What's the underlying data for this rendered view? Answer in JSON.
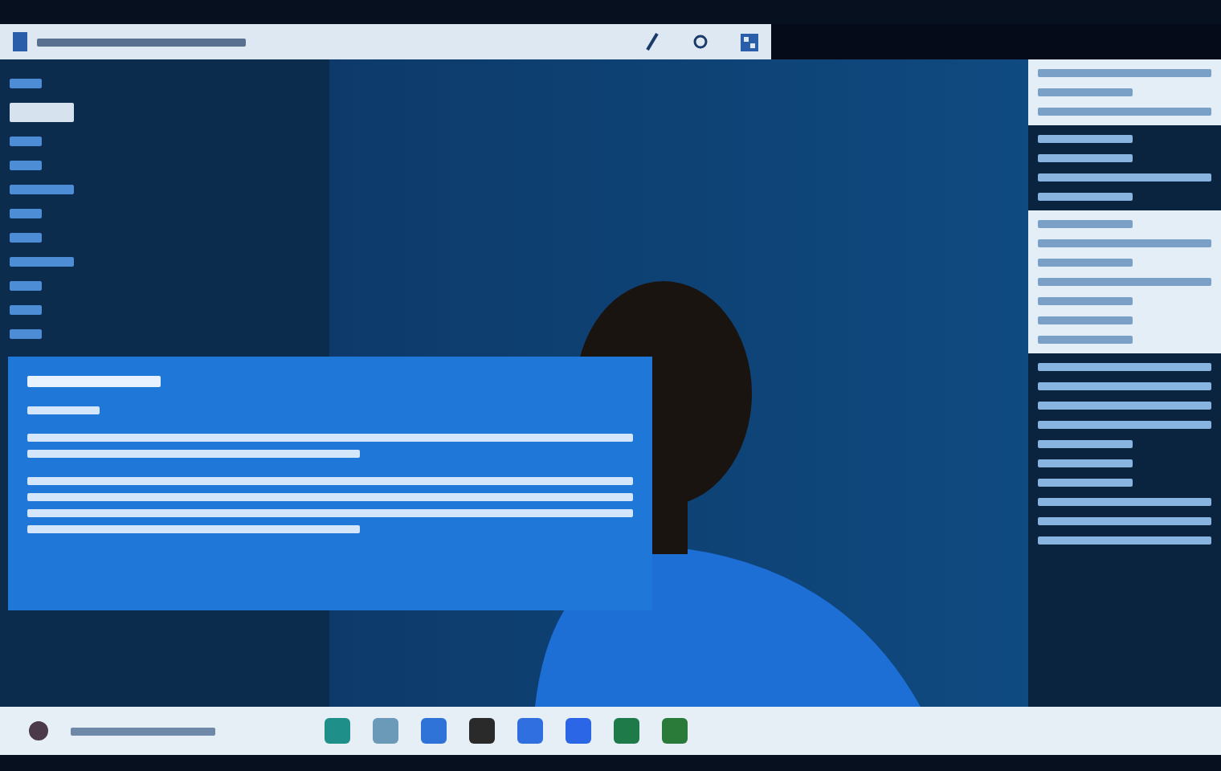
{
  "title_bar": {
    "controls": [
      {
        "kind": "pen"
      },
      {
        "kind": "ring"
      },
      {
        "kind": "grid"
      }
    ]
  },
  "sidebar": {
    "items": [
      {
        "selected": false,
        "kind": "short"
      },
      {
        "selected": true,
        "kind": "long"
      },
      {
        "selected": false,
        "kind": "short"
      },
      {
        "selected": false,
        "kind": "short"
      },
      {
        "selected": false,
        "kind": "long"
      },
      {
        "selected": false,
        "kind": "short"
      },
      {
        "selected": false,
        "kind": "short"
      },
      {
        "selected": false,
        "kind": "long"
      },
      {
        "selected": false,
        "kind": "short"
      },
      {
        "selected": false,
        "kind": "short"
      },
      {
        "selected": false,
        "kind": "short"
      }
    ]
  },
  "dialog": {
    "paragraphs": [
      {
        "kind": "heading",
        "lines": [
          {
            "kind": "short"
          }
        ]
      },
      {
        "kind": "label",
        "lines": [
          {
            "kind": "tiny"
          }
        ]
      },
      {
        "kind": "body",
        "lines": [
          {
            "kind": "full"
          },
          {
            "kind": "half"
          }
        ]
      },
      {
        "kind": "body",
        "lines": [
          {
            "kind": "full"
          },
          {
            "kind": "full"
          },
          {
            "kind": "full"
          },
          {
            "kind": "half"
          }
        ]
      }
    ]
  },
  "right_panel": {
    "sections": [
      {
        "kind": "light",
        "lines": [
          {
            "kind": "full"
          },
          {
            "kind": "half"
          },
          {
            "kind": "full"
          }
        ]
      },
      {
        "kind": "dark",
        "lines": [
          {
            "kind": "half"
          },
          {
            "kind": "half"
          },
          {
            "kind": "full"
          },
          {
            "kind": "half"
          }
        ]
      },
      {
        "kind": "light",
        "lines": [
          {
            "kind": "half"
          },
          {
            "kind": "full"
          },
          {
            "kind": "half"
          },
          {
            "kind": "full"
          },
          {
            "kind": "half"
          },
          {
            "kind": "half"
          },
          {
            "kind": "half"
          }
        ]
      },
      {
        "kind": "dark",
        "lines": [
          {
            "kind": "full"
          },
          {
            "kind": "full"
          },
          {
            "kind": "full"
          },
          {
            "kind": "full"
          },
          {
            "kind": "half"
          },
          {
            "kind": "half"
          },
          {
            "kind": "half"
          },
          {
            "kind": "full"
          },
          {
            "kind": "full"
          },
          {
            "kind": "full"
          }
        ]
      }
    ]
  },
  "taskbar": {
    "apps": [
      {
        "color": "#1f8f8a"
      },
      {
        "color": "#6a9ab8"
      },
      {
        "color": "#2f72d8"
      },
      {
        "color": "#2a2a2a"
      },
      {
        "color": "#2f6fe0"
      },
      {
        "color": "#2a66e6"
      },
      {
        "color": "#1f7a4a"
      },
      {
        "color": "#2a7a3a"
      }
    ]
  }
}
